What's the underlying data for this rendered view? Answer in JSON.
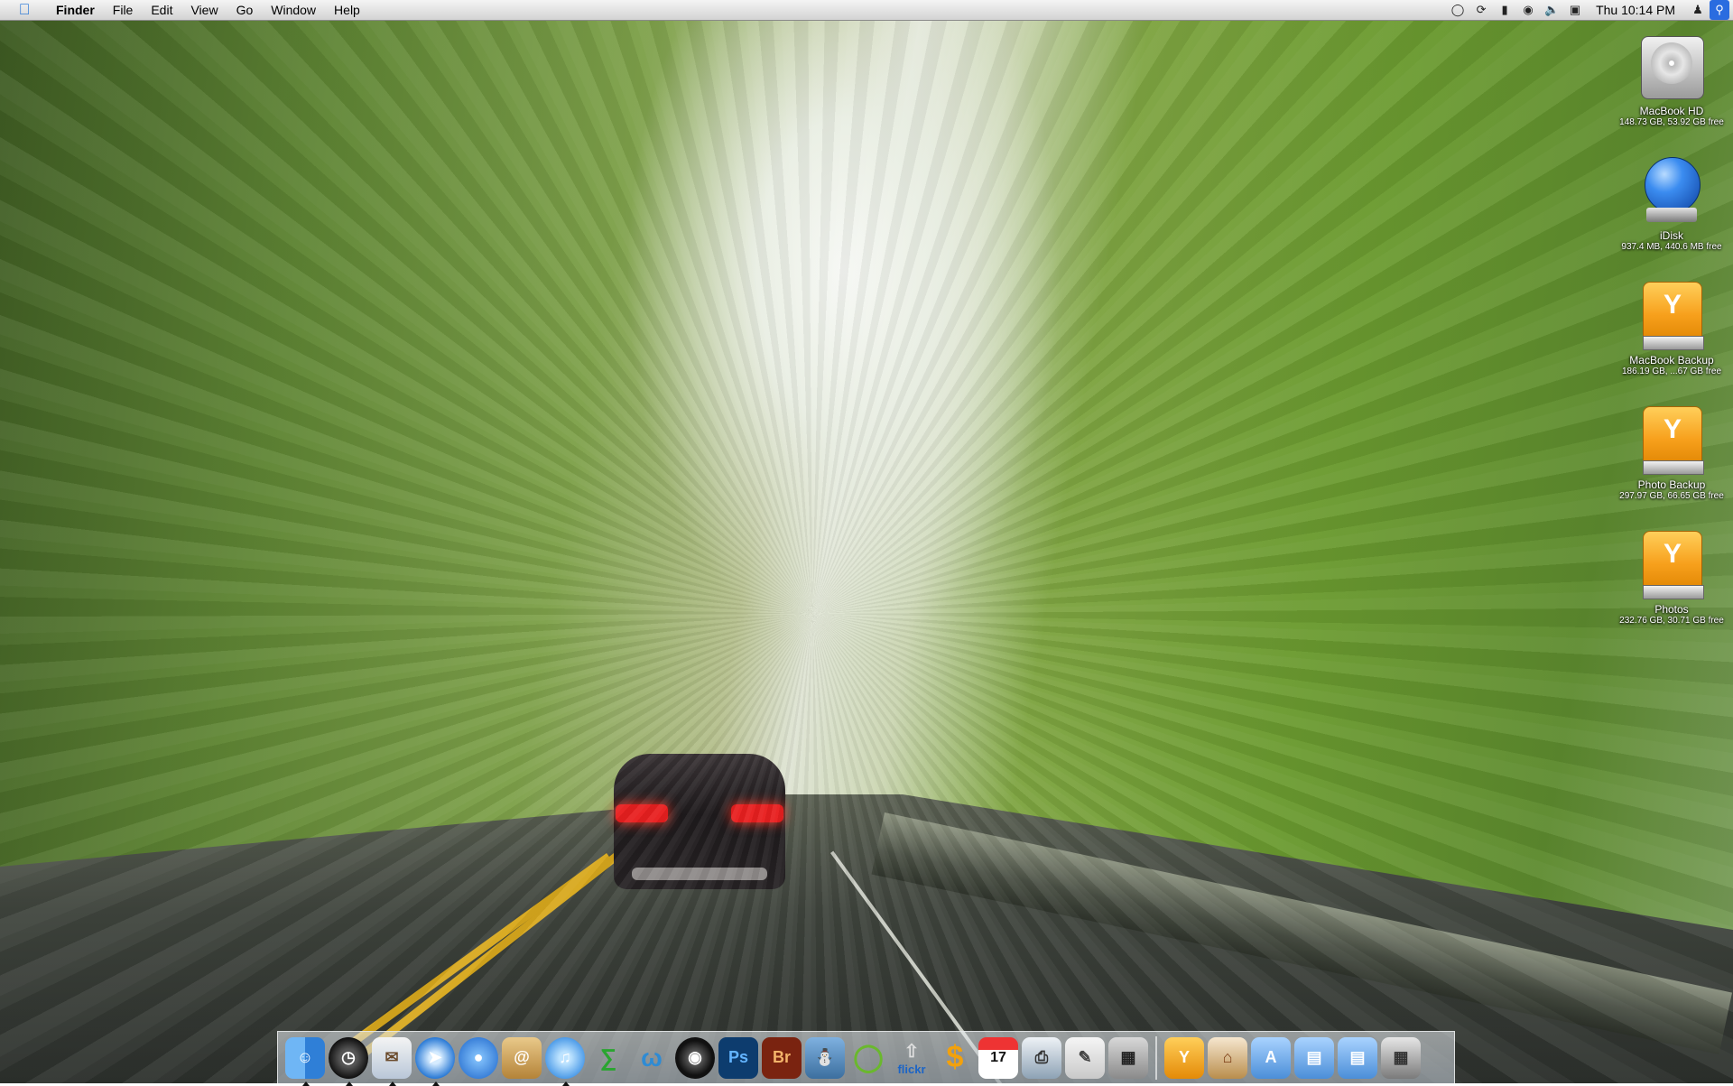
{
  "menubar": {
    "app_name": "Finder",
    "menus": [
      "File",
      "Edit",
      "View",
      "Go",
      "Window",
      "Help"
    ],
    "clock": "Thu 10:14 PM",
    "status_icons": [
      "time-machine-icon",
      "sync-icon",
      "battery-icon",
      "wifi-icon",
      "volume-icon",
      "display-icon",
      "user-icon",
      "spotlight-icon"
    ]
  },
  "desktop_icons": [
    {
      "name": "MacBook HD",
      "info": "148.73 GB, 53.92 GB free",
      "icon": "hard-drive-icon"
    },
    {
      "name": "iDisk",
      "info": "937.4 MB, 440.6 MB free",
      "icon": "idisk-icon"
    },
    {
      "name": "MacBook Backup",
      "info": "186.19 GB, ...67 GB free",
      "icon": "firewire-drive-icon"
    },
    {
      "name": "Photo Backup",
      "info": "297.97 GB, 66.65 GB free",
      "icon": "firewire-drive-icon"
    },
    {
      "name": "Photos",
      "info": "232.76 GB, 30.71 GB free",
      "icon": "firewire-drive-icon"
    }
  ],
  "dock": {
    "app_labels": {
      "photoshop": "Ps",
      "bridge": "Br",
      "ical_date": "17",
      "flickr": "flickr"
    }
  }
}
